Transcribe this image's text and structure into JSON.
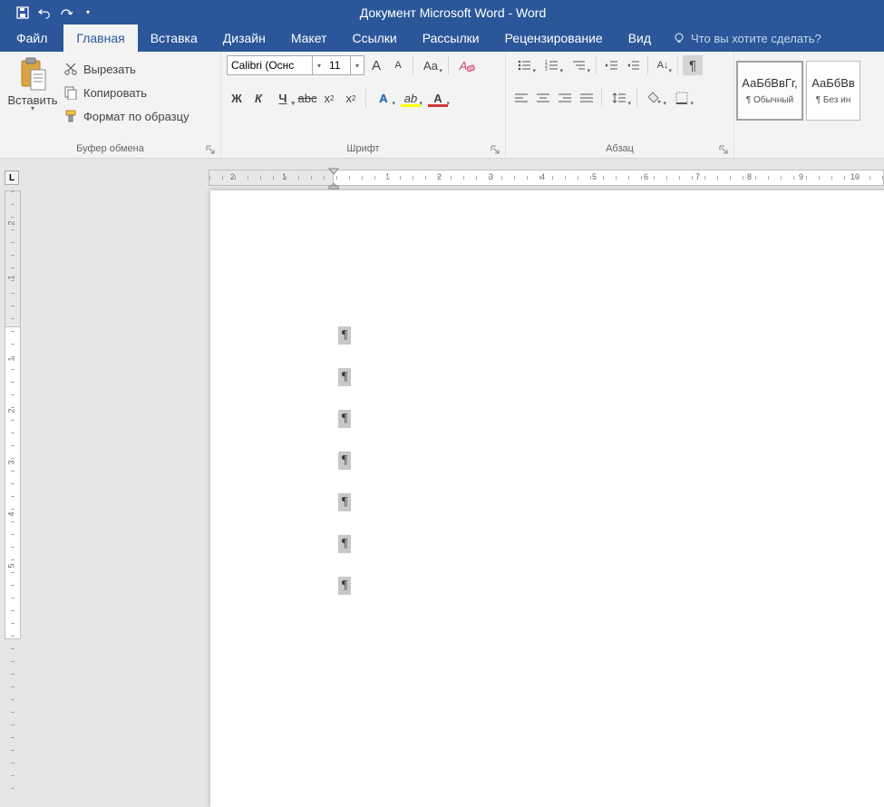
{
  "title": "Документ Microsoft Word - Word",
  "tabs": {
    "file": "Файл",
    "home": "Главная",
    "insert": "Вставка",
    "design": "Дизайн",
    "layout": "Макет",
    "references": "Ссылки",
    "mailings": "Рассылки",
    "review": "Рецензирование",
    "view": "Вид"
  },
  "tell_me_placeholder": "Что вы хотите сделать?",
  "clipboard": {
    "paste": "Вставить",
    "cut": "Вырезать",
    "copy": "Копировать",
    "format_painter": "Формат по образцу",
    "group_label": "Буфер обмена"
  },
  "font": {
    "name": "Calibri (Оснс",
    "size": "11",
    "group_label": "Шрифт",
    "bold": "Ж",
    "italic": "К",
    "underline": "Ч",
    "strike": "abc",
    "sub": "x",
    "sup": "x",
    "text_effects": "A",
    "highlight": "A",
    "font_color": "A",
    "grow": "A",
    "shrink": "A",
    "case": "Aa",
    "clear": "✦"
  },
  "paragraph": {
    "group_label": "Абзац"
  },
  "styles": {
    "preview": "АаБбВвГг,",
    "normal": "¶ Обычный",
    "preview2": "АаБбВв",
    "no_spacing": "¶ Без ин"
  },
  "hruler_labels": [
    "2",
    "1",
    "1",
    "2",
    "3",
    "4",
    "5",
    "6",
    "7",
    "8",
    "9",
    "10"
  ],
  "vruler_neg": [
    "2",
    "1"
  ],
  "vruler_pos": [
    "1",
    "2",
    "3",
    "4",
    "5"
  ],
  "pilcrow": "¶",
  "paragraph_marks": [
    150,
    196,
    242,
    288,
    334,
    380,
    426
  ]
}
